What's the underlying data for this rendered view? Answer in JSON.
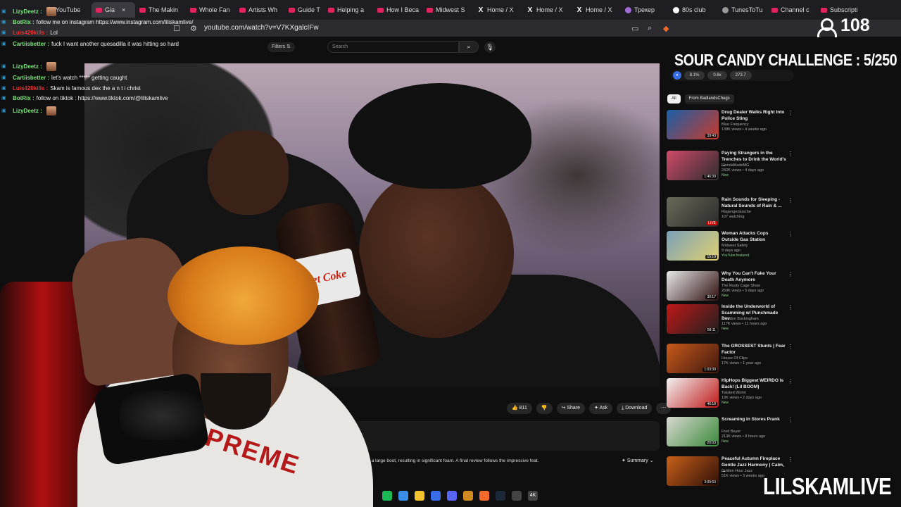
{
  "browser": {
    "tabs": [
      {
        "label": "YouTube",
        "icon": "youtube-icon"
      },
      {
        "label": "Gia",
        "icon": "youtube-icon",
        "active": true
      },
      {
        "label": "The Makin",
        "icon": "youtube-icon"
      },
      {
        "label": "Whole Fan",
        "icon": "youtube-icon"
      },
      {
        "label": "Artists Wh",
        "icon": "youtube-icon"
      },
      {
        "label": "Guide T",
        "icon": "youtube-icon"
      },
      {
        "label": "Helping a",
        "icon": "youtube-icon"
      },
      {
        "label": "How I Beca",
        "icon": "youtube-icon"
      },
      {
        "label": "Midwest S",
        "icon": "youtube-icon"
      },
      {
        "label": "Home / X",
        "icon": "x-icon"
      },
      {
        "label": "Home / X",
        "icon": "x-icon"
      },
      {
        "label": "Home / X",
        "icon": "x-icon"
      },
      {
        "label": "Трекер",
        "icon": "tracker-icon"
      },
      {
        "label": "80s club",
        "icon": "globe-icon"
      },
      {
        "label": "TunesToTu",
        "icon": "gear-icon"
      },
      {
        "label": "Channel c",
        "icon": "youtube-icon"
      },
      {
        "label": "Subscripti",
        "icon": "youtube-icon"
      }
    ],
    "url": "youtube.com/watch?v=V7KXgalcIFw",
    "tab_close": "×",
    "viewer_count": "108"
  },
  "youtube": {
    "filters_label": "Filters",
    "search_placeholder": "Search",
    "actions": {
      "like_count": "811",
      "share": "Share",
      "ask": "Ask",
      "download": "Download"
    },
    "summary_text": "d into a large boot, resulting in significant foam. A final review follows the impressive feat.",
    "summary_button": "Summary",
    "sidebar_stats": [
      "8.1%",
      "0.8x",
      "273.7"
    ],
    "chips": [
      "All",
      "From BadlandsChugs"
    ],
    "recommendations": [
      {
        "title": "Drug Dealer Walks Right Into Police Sting",
        "channel": "Blue Frequency",
        "meta": "138K views • 4 weeks ago",
        "duration": "39:43",
        "thumb": [
          "#1a5fa8",
          "#c83a2a"
        ]
      },
      {
        "title": "Paying Strangers in the Trenches to Drink the World's ...",
        "channel": "FloridaMadeMG",
        "meta": "242K views • 4 days ago",
        "badge": "New",
        "duration": "1:46:39",
        "thumb": [
          "#d04a6a",
          "#2e2e2e"
        ]
      },
      {
        "title": "Rain Sounds for Sleeping - Natural Sounds of Rain & ...",
        "channel": "Regengeräusche",
        "meta": "107 watching",
        "duration": "LIVE",
        "thumb": [
          "#6a6a5a",
          "#2a2a2a"
        ]
      },
      {
        "title": "Woman Attacks Cops Outside Gas Station",
        "channel": "Midwest Safety",
        "meta": "9 days ago",
        "badge": "YouTube featured",
        "duration": "15:19",
        "thumb": [
          "#7aa0b8",
          "#e0d070"
        ]
      },
      {
        "title": "Why You Can't Fake Your Death Anymore",
        "channel": "The Rusty Cage Show",
        "meta": "269K views • 5 days ago",
        "badge": "New",
        "duration": "30:17",
        "thumb": [
          "#e8e8e8",
          "#301010"
        ]
      },
      {
        "title": "Inside the Underworld of Scamming w/ Punchmade Dev",
        "channel": "Brandon Buckingham",
        "meta": "117K views • 11 hours ago",
        "badge": "New",
        "duration": "58:11",
        "thumb": [
          "#c01818",
          "#202020"
        ]
      },
      {
        "title": "The GROSSEST Stunts | Fear Factor",
        "channel": "House Of Clips",
        "meta": "17K views • 1 year ago",
        "duration": "1:03:39",
        "thumb": [
          "#c85a1a",
          "#401810"
        ]
      },
      {
        "title": "HipHops Biggest WEIRDO Is Back! (Lil BOOM)",
        "channel": "Twisted World",
        "meta": "13K views • 2 days ago",
        "badge": "New",
        "duration": "46:18",
        "thumb": [
          "#f2f2f2",
          "#c01818"
        ]
      },
      {
        "title": "Screaming in Stores Prank",
        "channel": "Fred Beyer",
        "meta": "213K views • 8 hours ago",
        "badge": "New",
        "duration": "20:03",
        "thumb": [
          "#d8d8d0",
          "#3a8a3a"
        ]
      },
      {
        "title": "Peaceful Autumn Fireplace Gentle Jazz Harmony | Calm, ...",
        "channel": "Golden Hour Jazz",
        "meta": "51K views • 3 weeks ago",
        "duration": "3:09:53",
        "thumb": [
          "#c8601a",
          "#301008"
        ]
      }
    ]
  },
  "chat": [
    {
      "user": "LizyDeetz",
      "text": "",
      "emote": true,
      "color": "green"
    },
    {
      "user": "BotRix",
      "text": "follow me on instagram https://www.instagram.com/liliskamlive/",
      "color": "green"
    },
    {
      "user": "Luis420kills",
      "text": "Lol",
      "color": "red"
    },
    {
      "user": "Cartiisbetter",
      "text": "fuck I want another quesadilla it was hitting so hard",
      "color": "green"
    },
    {
      "user": "LizyDeetz",
      "text": "",
      "emote": true,
      "color": "green"
    },
    {
      "user": "Cartiisbetter",
      "text": "let's watch ***** getting caught",
      "color": "green"
    },
    {
      "user": "Luis420kills",
      "text": "Skam is famous dex the a n t i christ",
      "color": "red"
    },
    {
      "user": "BotRix",
      "text": "follow on tiktok : https://www.tiktok.com/@liliskamlive",
      "color": "green"
    },
    {
      "user": "LizyDeetz",
      "text": "",
      "emote": true,
      "color": "green"
    }
  ],
  "overlay": {
    "challenge": "SOUR CANDY CHALLENGE : 5/250",
    "brand": "LILSKAMLIVE"
  },
  "video": {
    "bottle_label": "diet Coke"
  },
  "taskbar": [
    "spotify-icon",
    "copilot-icon",
    "folder-icon",
    "store-icon",
    "discord-icon",
    "winamp-icon",
    "brave-icon",
    "steam-icon",
    "obs-icon",
    "4k-icon"
  ]
}
